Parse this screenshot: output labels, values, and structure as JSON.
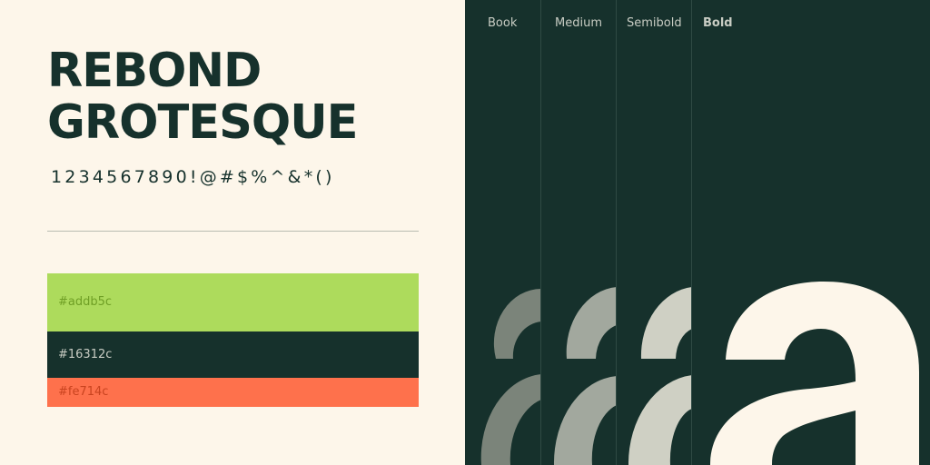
{
  "heading": {
    "line1": "REBOND",
    "line2": "GROTESQUE"
  },
  "glyph_sample": "1234567890!@#$%^&*()",
  "palette": [
    {
      "hex": "#addb5c",
      "label": "#addb5c",
      "text_color": "#6f9f25"
    },
    {
      "hex": "#16312c",
      "label": "#16312c",
      "text_color": "#c9cdc4"
    },
    {
      "hex": "#fe714c",
      "label": "#fe714c",
      "text_color": "#c9431f"
    }
  ],
  "weights": [
    "Book",
    "Medium",
    "Semibold",
    "Bold"
  ],
  "colors": {
    "background": "#fdf6ea",
    "panel": "#16312c",
    "book_glyph": "#7b847a",
    "medium_glyph": "#a2a89e",
    "semibold_glyph": "#cfd0c4",
    "bold_glyph": "#fdf6ea"
  }
}
